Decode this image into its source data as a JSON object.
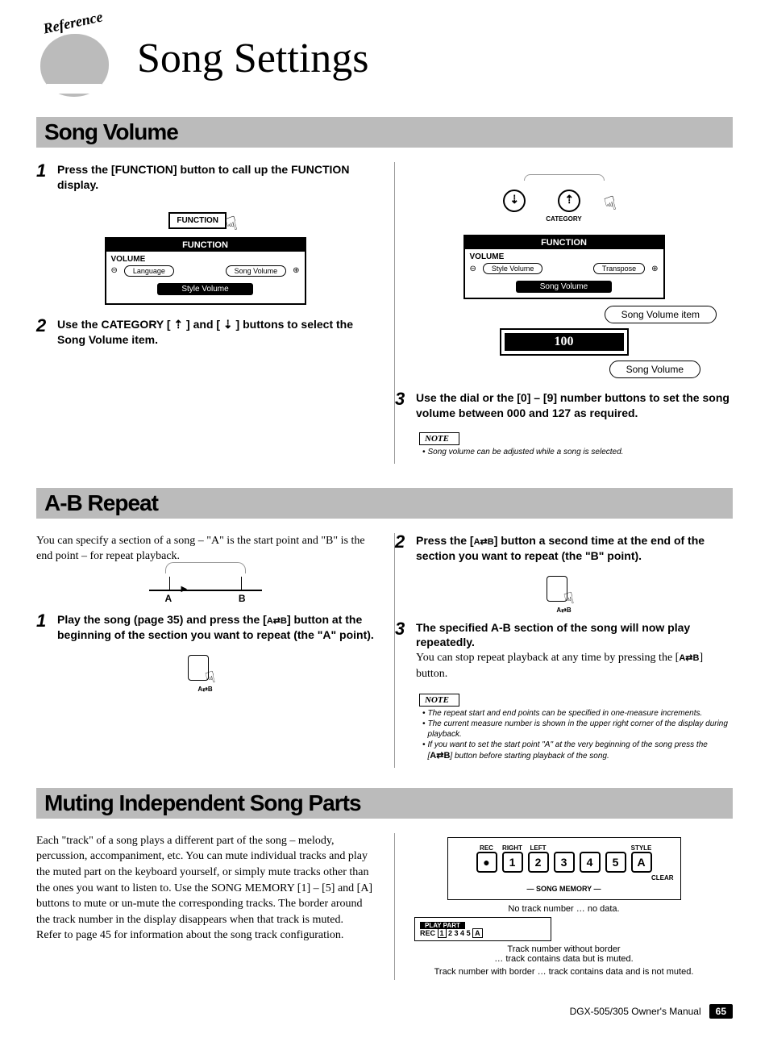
{
  "header": {
    "reference": "Reference",
    "title": "Song Settings"
  },
  "sections": {
    "song_volume": {
      "heading": "Song Volume",
      "step1": "Press the [FUNCTION] button to call up the FUNCTION display.",
      "function_btn": "FUNCTION",
      "lcd1": {
        "bar": "FUNCTION",
        "subtitle": "VOLUME",
        "left_item": "Language",
        "right_item": "Song Volume",
        "center": "Style Volume"
      },
      "step2": "Use the CATEGORY [ ⇡ ] and [ ⇣ ] buttons to select the Song Volume item.",
      "category_label": "CATEGORY",
      "lcd2": {
        "bar": "FUNCTION",
        "subtitle": "VOLUME",
        "left_item": "Style Volume",
        "right_item": "Transpose",
        "center": "Song Volume",
        "value": "100"
      },
      "callout1": "Song Volume item",
      "callout2": "Song Volume",
      "step3": "Use the dial or the [0] – [9] number buttons to set the song volume between 000 and 127 as required.",
      "note_label": "NOTE",
      "note1": "Song volume can be adjusted while a song is selected."
    },
    "ab_repeat": {
      "heading": "A-B Repeat",
      "intro": "You can specify a section of a song – \"A\" is the start point and \"B\" is the end point – for repeat playback.",
      "a_label": "A",
      "b_label": "B",
      "step1_a": "Play the song (page 35) and press the [",
      "step1_b": "] button at the beginning of the section you want to repeat (the \"A\" point).",
      "ab_icon": "A⇄B",
      "step2_a": "Press the [",
      "step2_b": "] button a second time at the end of the section you want to repeat (the \"B\" point).",
      "step3_bold": "The specified A-B section of the song will now play repeatedly.",
      "step3_normal_a": "You can stop repeat playback at any time by pressing the [",
      "step3_normal_b": "] button.",
      "note_label": "NOTE",
      "note1": "The repeat start and end points can be specified in one-measure increments.",
      "note2": "The current measure number is shown in the upper right corner of the display during playback.",
      "note3_a": "If you want to set the start point \"A\" at the very beginning of the song press the [",
      "note3_b": "] button before starting playback of the song."
    },
    "muting": {
      "heading": "Muting Independent Song Parts",
      "body": "Each \"track\" of a song plays a different part of the song – melody, percussion, accompaniment, etc. You can mute individual tracks and play the muted part on the keyboard yourself, or simply mute tracks other than the ones you want to listen to. Use the SONG MEMORY [1] – [5] and [A] buttons to mute or un-mute the corresponding tracks. The border around the track number in the display disappears when that track is muted.\nRefer to page 45 for information about the song track configuration.",
      "panel": {
        "labels": [
          "REC",
          "RIGHT",
          "LEFT",
          "",
          "",
          "",
          "STYLE"
        ],
        "btn_rec": "●",
        "buttons": [
          "1",
          "2",
          "3",
          "4",
          "5",
          "A"
        ],
        "clear": "CLEAR",
        "title": "SONG MEMORY"
      },
      "ann1": "No track number … no data.",
      "play_part": {
        "title": "PLAY PART",
        "rec": "REC",
        "tracks": "1 2 3 4 5 A"
      },
      "ann2": "Track number without border\n… track contains data but is muted.",
      "ann3": "Track number with border … track contains data and is not muted."
    }
  },
  "footer": {
    "manual": "DGX-505/305  Owner's Manual",
    "page": "65"
  }
}
